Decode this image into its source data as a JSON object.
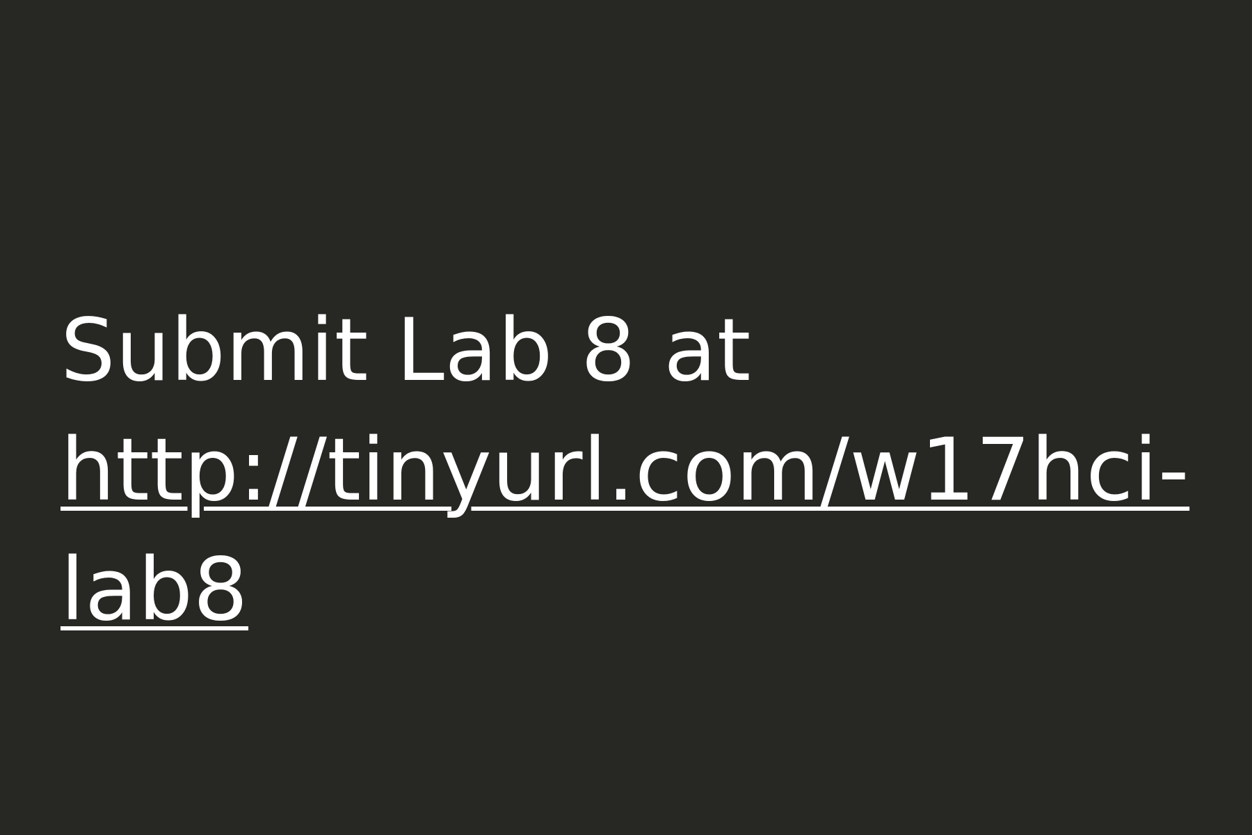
{
  "slide": {
    "text_prefix": "Submit Lab 8 at",
    "link_line1": "http://tinyurl.com/w17hci-",
    "link_line2": "lab8",
    "colors": {
      "background": "#272824",
      "text": "#ffffff"
    }
  }
}
